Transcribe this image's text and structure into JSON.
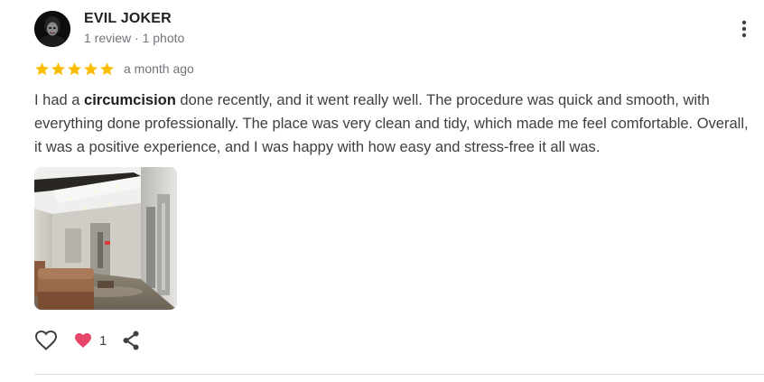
{
  "reviewer": {
    "name": "EVIL JOKER",
    "meta": "1 review · 1 photo",
    "avatar_icon": "joker-avatar"
  },
  "review": {
    "rating": 5,
    "max_rating": 5,
    "star_color": "#fbbc04",
    "date": "a month ago",
    "text_before": "I had a ",
    "text_bold": "circumcision",
    "text_after": " done recently, and it went really well. The procedure was quick and smooth, with everything done professionally. The place was very clean and tidy, which made me feel comfortable. Overall, it was a positive experience, and I was happy with how easy and stress-free it all was."
  },
  "photo": {
    "icon": "clinic-hallway-photo"
  },
  "actions": {
    "like_icon": "heart-outline-icon",
    "reaction_icon": "pink-heart-icon",
    "reaction_color": "#e8456b",
    "reaction_count": "1",
    "share_icon": "share-icon",
    "more_icon": "more-vert-icon"
  }
}
